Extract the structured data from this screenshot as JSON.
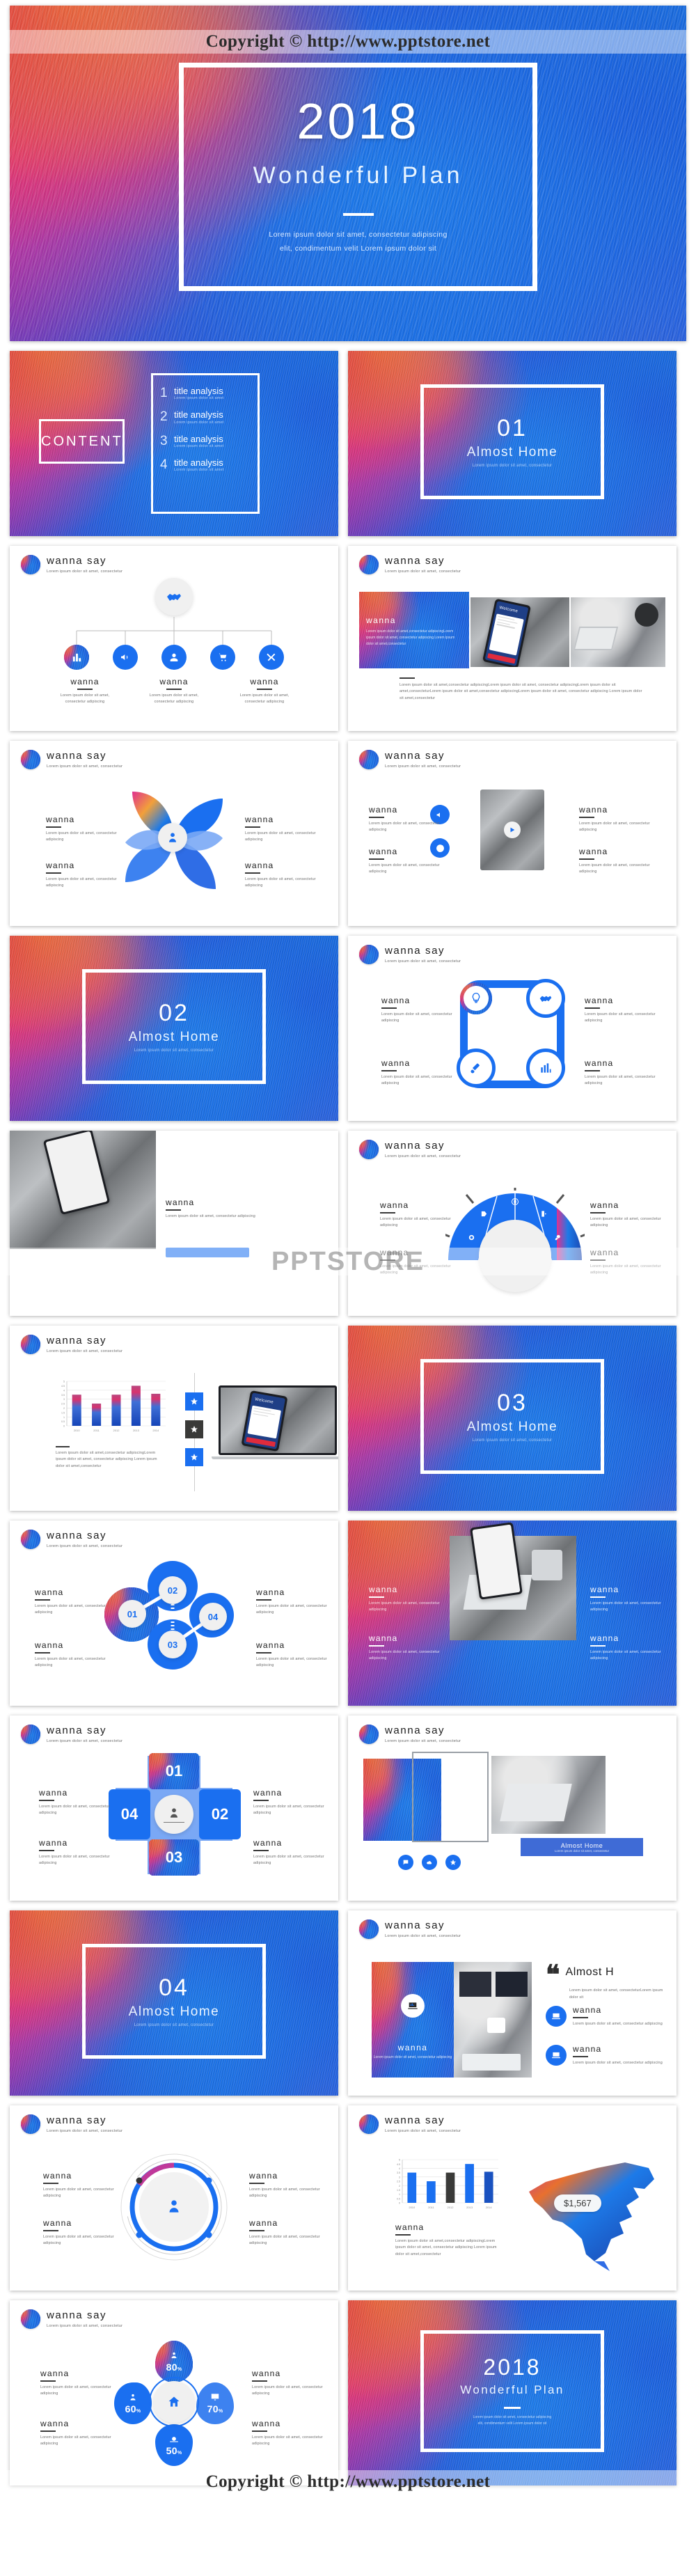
{
  "meta": {
    "watermark_top": "Copyright © http://www.pptstore.net",
    "watermark_bottom": "Copyright © http://www.pptstore.net",
    "watermark_mid": "PPTSTORE",
    "accent_blue": "#1a6ff0",
    "dark": "#3a3a3a"
  },
  "cover": {
    "year": "2018",
    "title": "Wonderful Plan",
    "subtitle_line1": "Lorem ipsum dolor sit amet, consectetur adipiscing",
    "subtitle_line2": "elit, condimentum velit Lorem ipsum dolor sit"
  },
  "agenda": {
    "label": "CONTENT",
    "items": [
      {
        "num": "1",
        "title": "title analysis",
        "sub": "Lorem ipsum dolor sit amet"
      },
      {
        "num": "2",
        "title": "title analysis",
        "sub": "Lorem ipsum dolor sit amet"
      },
      {
        "num": "3",
        "title": "title analysis",
        "sub": "Lorem ipsum dolor sit amet"
      },
      {
        "num": "4",
        "title": "title analysis",
        "sub": "Lorem ipsum dolor sit amet"
      }
    ]
  },
  "sections": [
    {
      "num": "01",
      "title": "Almost Home",
      "sub": "Lorem ipsum dolor sit amet, consectetur"
    },
    {
      "num": "02",
      "title": "Almost Home",
      "sub": "Lorem ipsum dolor sit amet, consectetur"
    },
    {
      "num": "03",
      "title": "Almost Home",
      "sub": "Lorem ipsum dolor sit amet, consectetur"
    },
    {
      "num": "04",
      "title": "Almost Home",
      "sub": "Lorem ipsum dolor sit amet, consectetur"
    }
  ],
  "slide_header": {
    "title": "wanna say",
    "subtitle": "Lorem ipsum dolor sit amet, consectetur"
  },
  "block": {
    "title": "wanna",
    "body": "Lorem ipsum dolor sit amet, consectetur adipiscing"
  },
  "tree_slide": {
    "icons": [
      "chart-icon",
      "megaphone-icon",
      "user-icon",
      "cart-icon",
      "tools-icon"
    ],
    "center_icon": "handshake-icon",
    "labels": [
      {
        "title": "wanna",
        "body": "Lorem ipsum dolor sit amet, consectetur adipiscing"
      },
      {
        "title": "wanna",
        "body": "Lorem ipsum dolor sit amet, consectetur adipiscing"
      },
      {
        "title": "wanna",
        "body": "Lorem ipsum dolor sit amet, consectetur adipiscing"
      }
    ]
  },
  "image_slide": {
    "overlay_title": "wanna",
    "overlay_body": "Lorem ipsum dolor sit amet,consectetur adipiscingLorem ipsum dolor sit amet, consectetur adipiscing Lorem ipsum dolor sit amet,consectetur",
    "caption": "Lorem ipsum dolor sit amet,consectetur adipiscingLorem ipsum dolor sit amet, consectetur adipiscingLorem ipsum dolor sit amet,consecteturLorem ipsum dolor sit amet,consectetur adipiscingLorem ipsum dolor sit amet, consectetur adipiscing Lorem ipsum dolor sit amet,consectetur",
    "phone_label": "Welcome"
  },
  "pinwheel_slide": {
    "center_icon": "businessman-icon"
  },
  "video_slide": {
    "play_icon": "play-icon",
    "side_icons": [
      "megaphone-icon",
      "clock-icon"
    ]
  },
  "rsq_slide": {
    "icons": [
      "bulb-icon",
      "handshake-icon",
      "rocket-icon",
      "chart-bars-icon"
    ]
  },
  "dial_slide": {
    "icons": [
      "tag-icon",
      "globe-icon",
      "device-icon",
      "target-icon",
      "key-icon"
    ]
  },
  "chart_slide": {
    "star_icons": [
      "star-icon",
      "star-icon",
      "star-icon"
    ],
    "body": "Lorem ipsum dolor sit amet,consectetur adipiscingLorem ipsum dolor sit amet, consectetur adipiscing Lorem ipsum dolor sit amet,consectetur"
  },
  "molecule_slide": {
    "nodes": [
      "01",
      "02",
      "03",
      "04"
    ]
  },
  "cross_slide": {
    "numbers": [
      "01",
      "02",
      "03",
      "04"
    ],
    "center_icon": "businessman-icon"
  },
  "quote_slide": {
    "quote_mark": "❝",
    "quote_title": "Almost H",
    "quote_body": "Lorem ipsum dolor sit amet, consecteturLorem ipsum dolor sit",
    "overlay_title": "wanna",
    "overlay_body": "Lorem ipsum dolor sit amet, consectetur adipiscing",
    "items": [
      {
        "icon": "laptop-chart-icon",
        "title": "wanna",
        "body": "Lorem ipsum dolor sit amet, consectetur adipiscing"
      },
      {
        "icon": "laptop-chart-icon",
        "title": "wanna",
        "body": "Lorem ipsum dolor sit amet, consectetur adipiscing"
      }
    ]
  },
  "device_slide": {
    "button_label": "",
    "bottom_icons": [
      "chat-icon",
      "cloud-icon",
      "star-icon"
    ],
    "banner_title": "Almost Home",
    "banner_sub": "Lorem ipsum dolor sit amet, consectetur"
  },
  "donut_slide": {
    "center_icon": "user-icon"
  },
  "pct_slide": {
    "center_icon": "home-icon",
    "items": [
      {
        "value": "80",
        "unit": "%",
        "icon": "user-group-icon",
        "position": "top"
      },
      {
        "value": "60",
        "unit": "%",
        "icon": "person-icon",
        "position": "left"
      },
      {
        "value": "70",
        "unit": "%",
        "icon": "monitor-icon",
        "position": "right"
      },
      {
        "value": "50",
        "unit": "%",
        "icon": "money-icon",
        "position": "bottom"
      }
    ]
  },
  "closing": {
    "year": "2018",
    "title": "Wonderful Plan",
    "subtitle_line1": "Lorem ipsum dolor sit amet, consectetur adipiscing",
    "subtitle_line2": "elit, condimentum velit Lorem ipsum dolor sit"
  },
  "chart_data": [
    {
      "type": "bar",
      "id": "chart-gradient-bars",
      "title": "",
      "categories": [
        "2010",
        "2011",
        "2012",
        "2013",
        "2014"
      ],
      "values": [
        3.5,
        2.5,
        3.5,
        4.5,
        3.6
      ],
      "ylim": [
        0,
        5
      ],
      "yticks": [
        "0",
        "0.5",
        "1",
        "1.5",
        "2",
        "2.5",
        "3",
        "3.5",
        "4",
        "4.5",
        "5"
      ],
      "xlabel": "",
      "ylabel": "",
      "grid": true,
      "legend": "none"
    },
    {
      "type": "bar",
      "id": "chart-blue-bars",
      "title": "",
      "categories": [
        "2010",
        "2011",
        "2012",
        "2013",
        "2014"
      ],
      "values": [
        3.5,
        2.5,
        3.5,
        4.5,
        3.6
      ],
      "colors": [
        "#1a6ff0",
        "#1a6ff0",
        "#3a3a38",
        "#1a6ff0",
        "#1a52c0"
      ],
      "ylim": [
        0,
        5
      ],
      "yticks": [
        "0",
        "0.5",
        "1",
        "1.5",
        "2",
        "2.5",
        "3",
        "3.5",
        "4",
        "4.5",
        "5"
      ],
      "xlabel": "",
      "ylabel": "",
      "grid": true,
      "legend": "none",
      "annotation": "$1,567"
    },
    {
      "type": "pie",
      "id": "chart-percent-bubbles",
      "labels": [
        "80%",
        "60%",
        "70%",
        "50%"
      ],
      "values": [
        80,
        60,
        70,
        50
      ],
      "title": ""
    }
  ]
}
